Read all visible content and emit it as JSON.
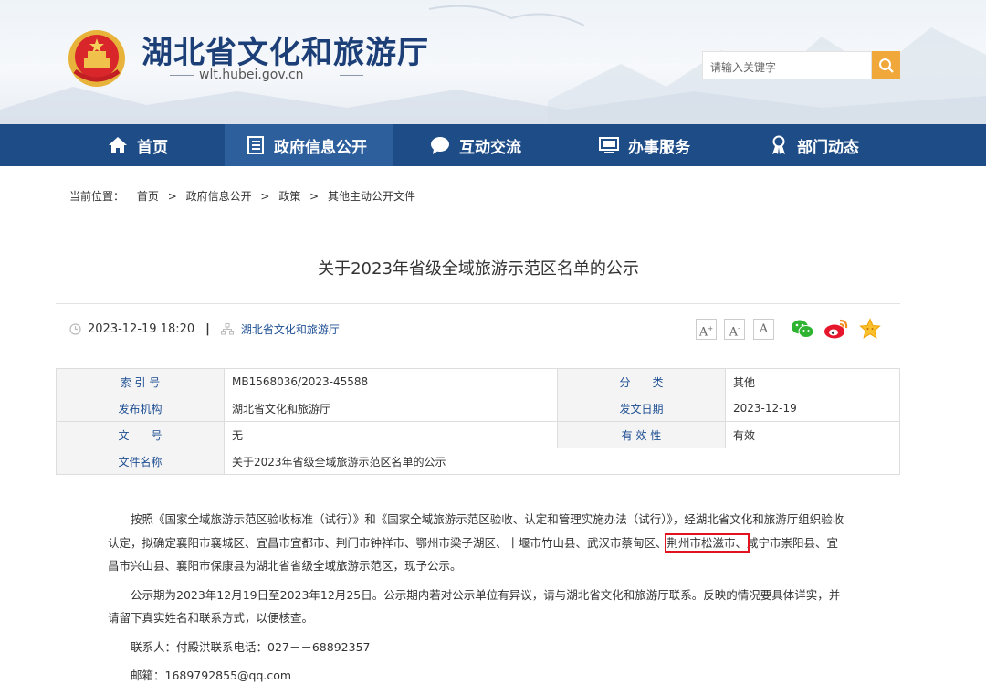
{
  "header": {
    "site_title": "湖北省文化和旅游厅",
    "site_url": "wlt.hubei.gov.cn",
    "search_placeholder": "请输入关键字"
  },
  "nav": [
    {
      "label": "首页",
      "icon": "home-icon"
    },
    {
      "label": "政府信息公开",
      "icon": "document-list-icon"
    },
    {
      "label": "互动交流",
      "icon": "chat-bubble-icon"
    },
    {
      "label": "办事服务",
      "icon": "monitor-icon"
    },
    {
      "label": "部门动态",
      "icon": "medal-icon"
    }
  ],
  "breadcrumb": {
    "prefix": "当前位置：",
    "items": [
      "首页",
      "政府信息公开",
      "政策",
      "其他主动公开文件"
    ],
    "separator": ">"
  },
  "article": {
    "title": "关于2023年省级全域旅游示范区名单的公示",
    "datetime": "2023-12-19 18:20",
    "separator": "|",
    "source": "湖北省文化和旅游厅",
    "font_sizes": [
      "A",
      "A",
      "A"
    ]
  },
  "info_table": {
    "rows": [
      {
        "k1": "索 引 号",
        "v1": "MB1568036/2023-45588",
        "k2": "分　　类",
        "v2": "其他"
      },
      {
        "k1": "发布机构",
        "v1": "湖北省文化和旅游厅",
        "k2": "发文日期",
        "v2": "2023-12-19"
      },
      {
        "k1": "文　　号",
        "v1": "无",
        "k2": "有 效 性",
        "v2": "有效"
      }
    ],
    "name_label": "文件名称",
    "name_value": "关于2023年省级全域旅游示范区名单的公示"
  },
  "content": {
    "p1_before": "按照《国家全域旅游示范区验收标准（试行）》和《国家全域旅游示范区验收、认定和管理实施办法（试行）》，经湖北省文化和旅游厅组织验收认定，拟确定襄阳市襄城区、宜昌市宜都市、荆门市钟祥市、鄂州市梁子湖区、十堰市竹山县、武汉市蔡甸区、",
    "p1_highlight": "荆州市松滋市、",
    "p1_after": "咸宁市崇阳县、宜昌市兴山县、襄阳市保康县为湖北省省级全域旅游示范区，现予公示。",
    "p2": "公示期为2023年12月19日至2023年12月25日。公示期内若对公示单位有异议，请与湖北省文化和旅游厅联系。反映的情况要具体详实，并请留下真实姓名和联系方式，以便核查。",
    "p3": "联系人：付殿洪联系电话：027－－68892357",
    "p4": "邮箱：1689792855@qq.com"
  },
  "colors": {
    "nav_bg": "#1d4c87",
    "nav_active": "#2d5f9c",
    "search_btn": "#f0a83a",
    "highlight": "#e0131e"
  }
}
